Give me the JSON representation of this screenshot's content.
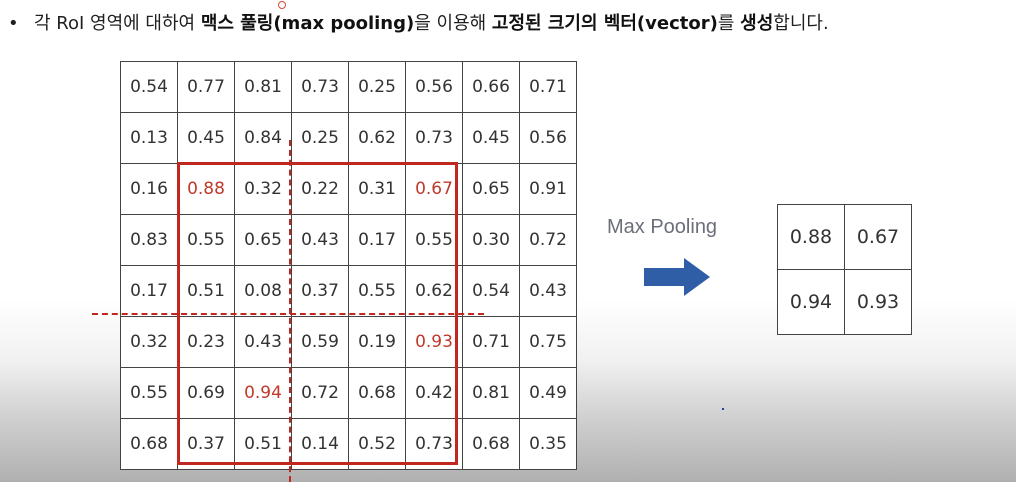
{
  "headline": {
    "bullet": "•",
    "part1": "각 RoI 영역에 대하여 ",
    "bold1": "맥스 풀링(max pooling)",
    "part2": "을 이용해 ",
    "bold2": "고정된 크기의 벡터(vector)",
    "part3": "를 ",
    "bold3": "생성",
    "part4": "합니다."
  },
  "grid": {
    "rows": [
      [
        "0.54",
        "0.77",
        "0.81",
        "0.73",
        "0.25",
        "0.56",
        "0.66",
        "0.71"
      ],
      [
        "0.13",
        "0.45",
        "0.84",
        "0.25",
        "0.62",
        "0.73",
        "0.45",
        "0.56"
      ],
      [
        "0.16",
        "0.88",
        "0.32",
        "0.22",
        "0.31",
        "0.67",
        "0.65",
        "0.91"
      ],
      [
        "0.83",
        "0.55",
        "0.65",
        "0.43",
        "0.17",
        "0.55",
        "0.30",
        "0.72"
      ],
      [
        "0.17",
        "0.51",
        "0.08",
        "0.37",
        "0.55",
        "0.62",
        "0.54",
        "0.43"
      ],
      [
        "0.32",
        "0.23",
        "0.43",
        "0.59",
        "0.19",
        "0.93",
        "0.71",
        "0.75"
      ],
      [
        "0.55",
        "0.69",
        "0.94",
        "0.72",
        "0.68",
        "0.42",
        "0.81",
        "0.49"
      ],
      [
        "0.68",
        "0.37",
        "0.51",
        "0.14",
        "0.52",
        "0.73",
        "0.68",
        "0.35"
      ]
    ],
    "highlight_color": "#c0392b"
  },
  "max_pooling_label": "Max Pooling",
  "arrow_color": "#2f5da6",
  "result": {
    "rows": [
      [
        "0.88",
        "0.67"
      ],
      [
        "0.94",
        "0.93"
      ]
    ]
  }
}
